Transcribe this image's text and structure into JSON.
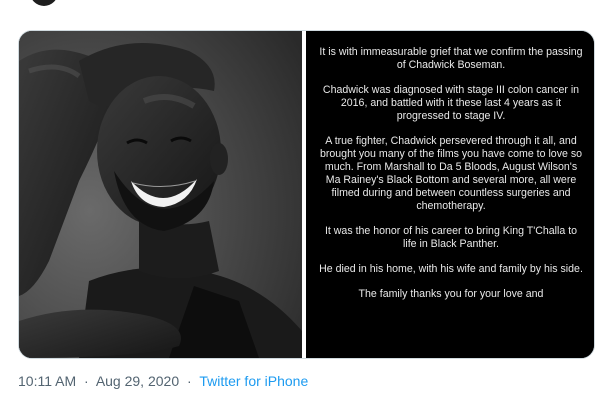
{
  "tweet": {
    "statement_paragraphs": [
      "It is with immeasurable grief that we confirm the passing of Chadwick Boseman.",
      "Chadwick was diagnosed with stage III colon cancer in 2016, and battled with it these last 4 years as it progressed to stage IV.",
      "A true fighter, Chadwick persevered through it all, and brought you many of the films you have come to love so much. From Marshall to Da 5 Bloods, August Wilson's Ma Rainey's Black Bottom and several more, all were filmed during and between countless surgeries and chemotherapy.",
      "It was the honor of his career to bring King T'Challa to life in Black Panther.",
      "He died in his home, with his wife and family by his side.",
      "The family thanks you for your love and"
    ],
    "time": "10:11 AM",
    "separator": "·",
    "date": "Aug 29, 2020",
    "source": "Twitter for iPhone"
  },
  "colors": {
    "meta_text": "#536471",
    "link": "#1d9bf0",
    "statement_bg": "#000000",
    "statement_text": "#e9e9e9"
  }
}
